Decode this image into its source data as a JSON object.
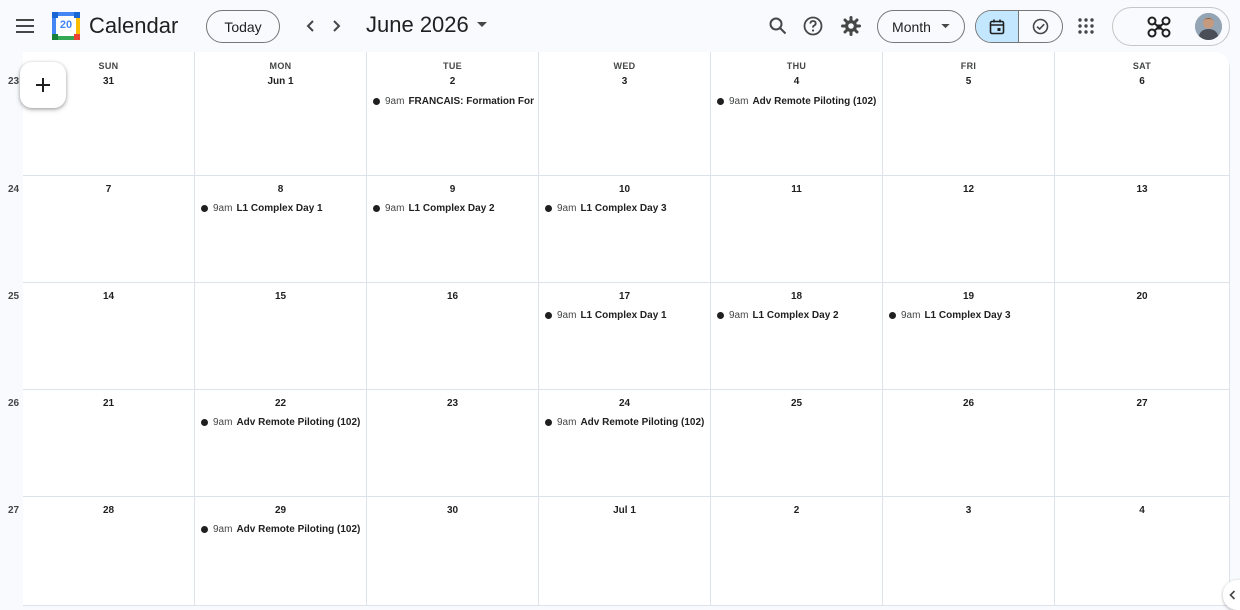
{
  "header": {
    "app_title": "Calendar",
    "logo_day": "20",
    "today_label": "Today",
    "date_title": "June 2026",
    "view_label": "Month"
  },
  "weekdays": [
    "SUN",
    "MON",
    "TUE",
    "WED",
    "THU",
    "FRI",
    "SAT"
  ],
  "weeks": [
    {
      "week_number": "23",
      "days": [
        {
          "label": "31",
          "events": []
        },
        {
          "label": "Jun 1",
          "events": []
        },
        {
          "label": "2",
          "events": [
            {
              "time": "9am",
              "title": "FRANCAIS: Formation Fon"
            }
          ]
        },
        {
          "label": "3",
          "events": []
        },
        {
          "label": "4",
          "events": [
            {
              "time": "9am",
              "title": "Adv Remote Piloting (102)"
            }
          ]
        },
        {
          "label": "5",
          "events": []
        },
        {
          "label": "6",
          "events": []
        }
      ]
    },
    {
      "week_number": "24",
      "days": [
        {
          "label": "7",
          "events": []
        },
        {
          "label": "8",
          "events": [
            {
              "time": "9am",
              "title": "L1 Complex Day 1"
            }
          ]
        },
        {
          "label": "9",
          "events": [
            {
              "time": "9am",
              "title": "L1 Complex Day 2"
            }
          ]
        },
        {
          "label": "10",
          "events": [
            {
              "time": "9am",
              "title": "L1 Complex Day 3"
            }
          ]
        },
        {
          "label": "11",
          "events": []
        },
        {
          "label": "12",
          "events": []
        },
        {
          "label": "13",
          "events": []
        }
      ]
    },
    {
      "week_number": "25",
      "days": [
        {
          "label": "14",
          "events": []
        },
        {
          "label": "15",
          "events": []
        },
        {
          "label": "16",
          "events": []
        },
        {
          "label": "17",
          "events": [
            {
              "time": "9am",
              "title": "L1 Complex Day 1"
            }
          ]
        },
        {
          "label": "18",
          "events": [
            {
              "time": "9am",
              "title": "L1 Complex Day 2"
            }
          ]
        },
        {
          "label": "19",
          "events": [
            {
              "time": "9am",
              "title": "L1 Complex Day 3"
            }
          ]
        },
        {
          "label": "20",
          "events": []
        }
      ]
    },
    {
      "week_number": "26",
      "days": [
        {
          "label": "21",
          "events": []
        },
        {
          "label": "22",
          "events": [
            {
              "time": "9am",
              "title": "Adv Remote Piloting (102)"
            }
          ]
        },
        {
          "label": "23",
          "events": []
        },
        {
          "label": "24",
          "events": [
            {
              "time": "9am",
              "title": "Adv Remote Piloting (102)"
            }
          ]
        },
        {
          "label": "25",
          "events": []
        },
        {
          "label": "26",
          "events": []
        },
        {
          "label": "27",
          "events": []
        }
      ]
    },
    {
      "week_number": "27",
      "days": [
        {
          "label": "28",
          "events": []
        },
        {
          "label": "29",
          "events": [
            {
              "time": "9am",
              "title": "Adv Remote Piloting (102)"
            }
          ]
        },
        {
          "label": "30",
          "events": []
        },
        {
          "label": "Jul 1",
          "events": []
        },
        {
          "label": "2",
          "events": []
        },
        {
          "label": "3",
          "events": []
        },
        {
          "label": "4",
          "events": []
        }
      ]
    }
  ],
  "icons": {
    "menu": "hamburger-menu-icon",
    "prev": "chevron-left-icon",
    "next": "chevron-right-icon",
    "search": "search-icon",
    "help": "help-icon",
    "settings": "gear-icon",
    "apps": "apps-grid-icon",
    "calendar_view": "calendar-icon",
    "tasks_view": "task-check-icon",
    "create": "plus-icon"
  },
  "colors": {
    "accent_selected": "#c2e7ff",
    "event_dot": "#1f1f1f",
    "logo_blue": "#4285f4"
  }
}
